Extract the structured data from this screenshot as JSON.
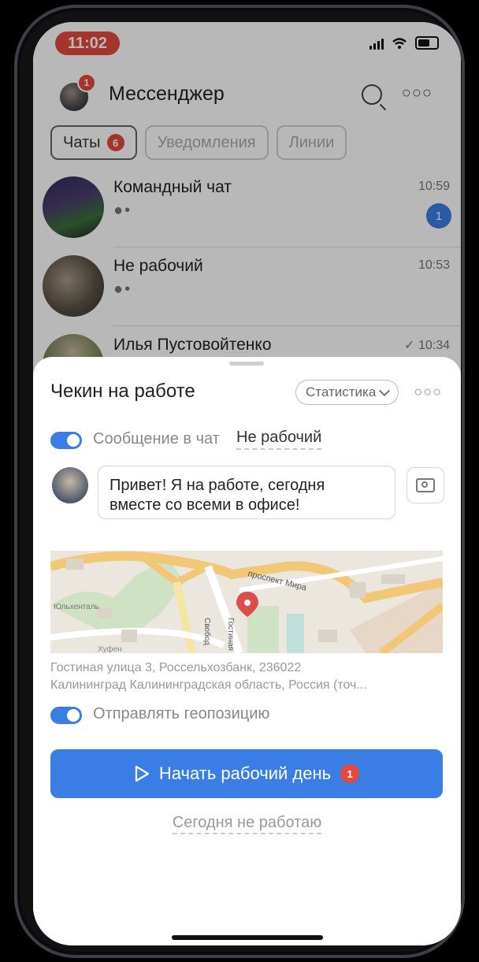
{
  "status_bar": {
    "time": "11:02"
  },
  "header": {
    "title": "Мессенджер",
    "avatar_badge": "1"
  },
  "tabs": [
    {
      "label": "Чаты",
      "badge": "6",
      "active": true
    },
    {
      "label": "Уведомления",
      "active": false
    },
    {
      "label": "Линии",
      "active": false
    }
  ],
  "chats": [
    {
      "name": "Командный чат",
      "time": "10:59",
      "preview": "●•",
      "unread": "1"
    },
    {
      "name": "Не рабочий",
      "time": "10:53",
      "preview": "●•"
    },
    {
      "name": "Илья Пустовойтенко",
      "time": "✓ 10:34"
    }
  ],
  "checkin": {
    "title": "Чекин на работе",
    "stats_button": "Статистика",
    "send_to_chat_label": "Сообщение в чат",
    "send_to_chat_enabled": true,
    "target_chat": "Не рабочий",
    "message_line1": "Привет! Я на работе, сегодня",
    "message_line2": "вместе со всеми в офисе!",
    "map": {
      "street_labels": [
        "проспект Мира",
        "Свобод",
        "Гостиная",
        "Юльхенталь",
        "Хуфен"
      ]
    },
    "address_line1": "Гостиная улица 3, Россельхозбанк, 236022",
    "address_line2": "Калининград Калининградская область, Россия (точ...",
    "send_geo_label": "Отправлять геопозицию",
    "send_geo_enabled": true,
    "start_button": "Начать рабочий день",
    "start_badge": "1",
    "not_working_link": "Сегодня не работаю"
  },
  "colors": {
    "accent": "#3a7de4",
    "badge": "#e24a3e"
  }
}
